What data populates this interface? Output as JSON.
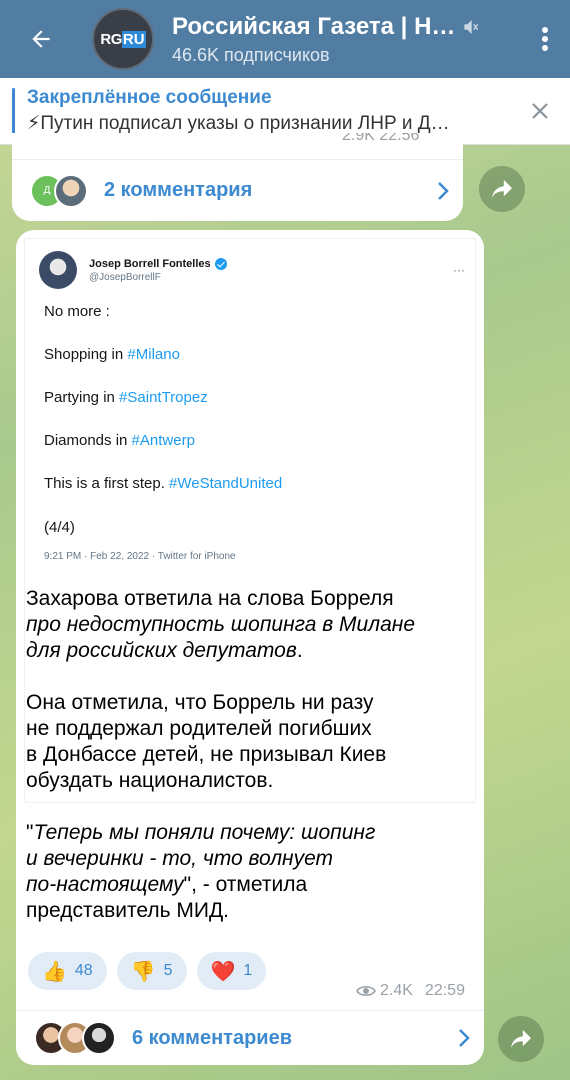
{
  "header": {
    "title": "Российская Газета | Н…",
    "subscribers": "46.6K подписчиков",
    "logo_left": "RG",
    "logo_right": "RU"
  },
  "pinned": {
    "title": "Закреплённое сообщение",
    "message": "⚡Путин подписал указы о признании ЛНР и Д…"
  },
  "prev_post": {
    "partial_meta": "2.9K  22:56",
    "comments_label": "2 комментария",
    "avatar_letter": "Д"
  },
  "tweet": {
    "author": "Josep Borrell Fontelles",
    "handle": "@JosepBorrellF",
    "more": "···",
    "lines": [
      {
        "text": "No more :",
        "tag": ""
      },
      {
        "text": "Shopping in ",
        "tag": "#Milano"
      },
      {
        "text": "Partying in ",
        "tag": "#SaintTropez"
      },
      {
        "text": "Diamonds in ",
        "tag": "#Antwerp"
      },
      {
        "text": "This is a first step. ",
        "tag": "#WeStandUnited"
      },
      {
        "text": "(4/4)",
        "tag": ""
      }
    ],
    "meta": "9:21 PM · Feb 22, 2022 · Twitter for iPhone"
  },
  "post": {
    "p1_plain": "Захарова ответила на слова Борреля",
    "p1_italic_a": "про недоступность шопинга в Милане",
    "p1_italic_b": "для российских депутатов",
    "p1_end": ".",
    "p2_l1": "Она отметила, что Боррель ни разу",
    "p2_l2": "не поддержал родителей погибших",
    "p2_l3": "в Донбассе детей, не призывал Киев",
    "p2_l4": "обуздать националистов.",
    "p3_quote_open": "\"",
    "p3_italic_a": "Теперь мы поняли почему: шопинг",
    "p3_italic_b": "и вечеринки - то, что волнует",
    "p3_italic_c": "по-настоящему",
    "p3_end_a": "\", - отметила",
    "p3_end_b": "представитель МИД."
  },
  "reactions": [
    {
      "emoji": "👍",
      "count": "48"
    },
    {
      "emoji": "👎",
      "count": "5"
    },
    {
      "emoji": "❤️",
      "count": "1"
    }
  ],
  "post_meta": {
    "views": "2.4K",
    "time": "22:59"
  },
  "comments": {
    "label": "6 комментариев"
  },
  "colors": {
    "header_bg": "#527da3",
    "accent": "#3d8ad0",
    "twitter_blue": "#1d9bf0"
  },
  "icons": [
    "back-arrow-icon",
    "mute-icon",
    "more-vert-icon",
    "close-icon",
    "chevron-right-icon",
    "share-icon",
    "eye-icon",
    "verified-icon"
  ]
}
